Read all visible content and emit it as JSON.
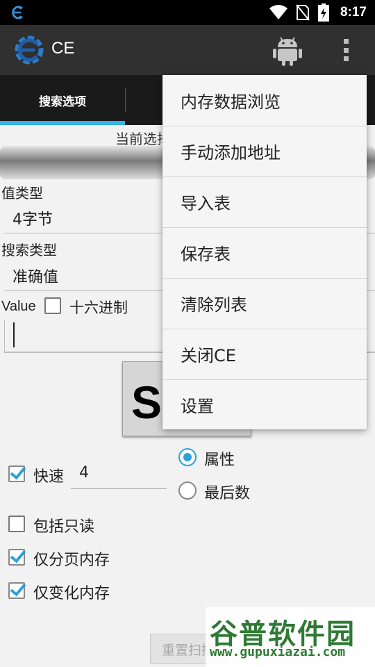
{
  "status_bar": {
    "time": "8:17",
    "icons": [
      "wifi-icon",
      "no-sim-icon",
      "battery-charging-icon"
    ]
  },
  "action_bar": {
    "title": "CE",
    "icons": [
      "cheat-engine-logo",
      "android-icon",
      "overflow-menu-icon"
    ]
  },
  "tabs": [
    {
      "label": "搜索选项",
      "selected": true
    }
  ],
  "form": {
    "current_label": "当前选择",
    "value_type_label": "值类型",
    "value_type_value": "4字节",
    "search_type_label": "搜索类型",
    "search_type_value": "准确值",
    "value_label": "Value",
    "hex_label": "十六进制",
    "scan_button": "S",
    "fast_label": "快速",
    "fast_value": "4",
    "radio_attribute": "属性",
    "radio_last_digits": "最后数",
    "include_readonly": "包括只读",
    "paged_memory_only": "仅分页内存",
    "changed_memory_only": "仅变化内存",
    "reset_scan": "重置扫描"
  },
  "popup_menu": {
    "items": [
      "内存数据浏览",
      "手动添加地址",
      "导入表",
      "保存表",
      "清除列表",
      "关闭CE",
      "设置"
    ]
  },
  "watermark": {
    "title": "谷普软件园",
    "url": "www.gupuxiazai.com"
  },
  "colors": {
    "accent": "#33b5e5",
    "checkbox": "#2aa3d8",
    "action_bar": "#303030",
    "tab_bar": "#1a1a1a",
    "watermark": "#2e7a35"
  }
}
